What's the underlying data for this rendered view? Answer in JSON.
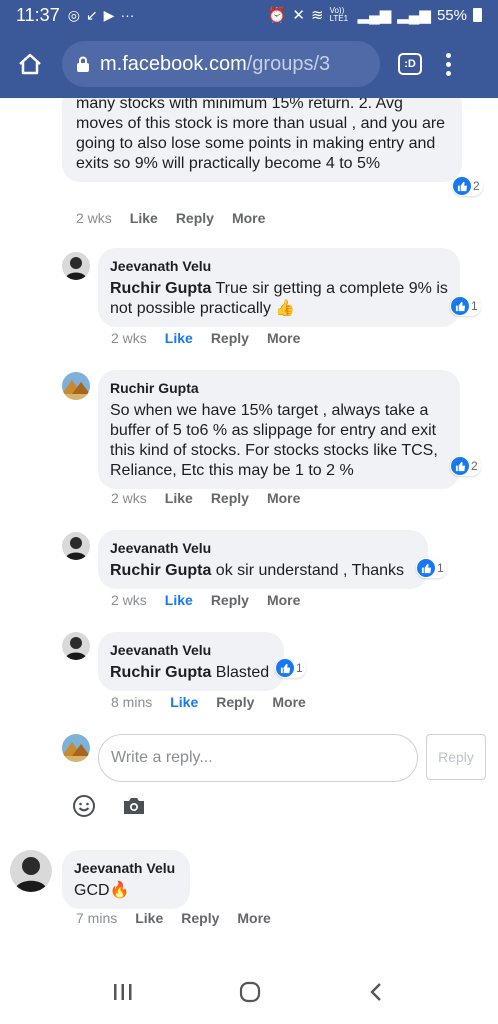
{
  "status": {
    "time": "11:37",
    "battery": "55%",
    "volte": "Vo)) LTE1"
  },
  "browser": {
    "url_host": "m.facebook.com",
    "url_path": "/groups/3",
    "tabs_label": ":D"
  },
  "comments": [
    {
      "text": "many stocks with minimum 15% return. 2. Avg moves of this stock is more than usual , and you are going to also lose some points in making entry and exits so 9% will practically become 4 to 5%",
      "reactions": "2",
      "time": "2 wks",
      "like": "Like",
      "reply": "Reply",
      "more": "More"
    },
    {
      "author": "Jeevanath Velu",
      "mention": "Ruchir Gupta",
      "text": " True sir getting a complete 9% is not possible practically 👍",
      "reactions": "1",
      "time": "2 wks",
      "like": "Like",
      "reply": "Reply",
      "more": "More"
    },
    {
      "author": "Ruchir Gupta",
      "text": "So when we have 15% target , always take a buffer of 5 to6 % as slippage for entry and exit this kind of stocks. For stocks stocks like TCS, Reliance, Etc this may be 1 to 2 %",
      "reactions": "2",
      "time": "2 wks",
      "like": "Like",
      "reply": "Reply",
      "more": "More"
    },
    {
      "author": "Jeevanath Velu",
      "mention": "Ruchir Gupta",
      "text": " ok sir understand , Thanks",
      "reactions": "1",
      "time": "2 wks",
      "like": "Like",
      "reply": "Reply",
      "more": "More"
    },
    {
      "author": "Jeevanath Velu",
      "mention": "Ruchir Gupta",
      "text": " Blasted",
      "reactions": "1",
      "time": "8 mins",
      "like": "Like",
      "reply": "Reply",
      "more": "More"
    },
    {
      "author": "Jeevanath Velu",
      "text": "GCD🔥",
      "time": "7 mins",
      "like": "Like",
      "reply": "Reply",
      "more": "More"
    }
  ],
  "reply_input": {
    "placeholder": "Write a reply...",
    "button": "Reply"
  },
  "colors": {
    "brand": "#3b5998",
    "like_blue": "#1877f2"
  }
}
